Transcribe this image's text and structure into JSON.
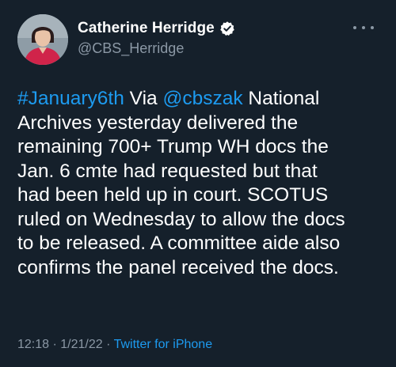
{
  "author": {
    "display_name": "Catherine Herridge",
    "handle": "@CBS_Herridge",
    "verified_icon": "verified-badge-icon"
  },
  "more_icon": "more-options-icon",
  "tweet": {
    "lines": [
      [
        {
          "text": "#January6th",
          "kind": "hashtag"
        },
        {
          "text": " Via ",
          "kind": "text"
        },
        {
          "text": "@cbszak",
          "kind": "mention"
        },
        {
          "text": " National",
          "kind": "text"
        }
      ],
      [
        {
          "text": "Archives yesterday delivered the",
          "kind": "text"
        }
      ],
      [
        {
          "text": "remaining 700+ Trump WH docs the",
          "kind": "text"
        }
      ],
      [
        {
          "text": "Jan. 6 cmte had requested but that",
          "kind": "text"
        }
      ],
      [
        {
          "text": "had been held up in court. SCOTUS",
          "kind": "text"
        }
      ],
      [
        {
          "text": "ruled on Wednesday to allow the docs",
          "kind": "text"
        }
      ],
      [
        {
          "text": "to be released. A committee aide also",
          "kind": "text"
        }
      ],
      [
        {
          "text": "confirms the panel received the docs.",
          "kind": "text"
        }
      ]
    ]
  },
  "meta": {
    "time": "12:18",
    "separator1": " · ",
    "date": "1/21/22",
    "separator2": " · ",
    "source": "Twitter for iPhone"
  },
  "colors": {
    "background": "#15202b",
    "link": "#1d9bf0",
    "secondary_text": "#8b98a5"
  }
}
